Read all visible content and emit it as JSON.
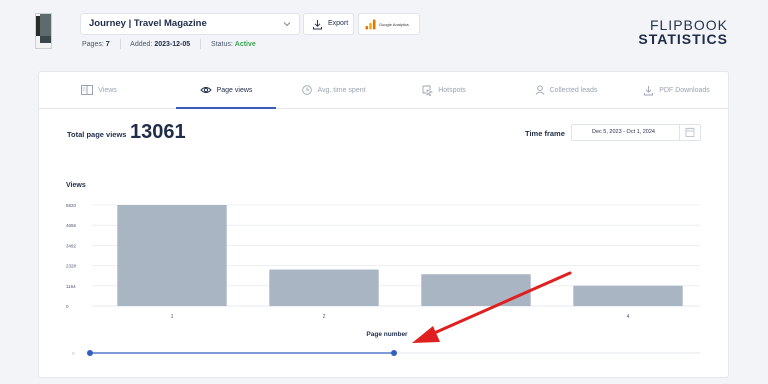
{
  "header": {
    "magazine_title": "Journey | Travel Magazine",
    "pages_label": "Pages:",
    "pages_value": "7",
    "added_label": "Added:",
    "added_value": "2023-12-05",
    "status_label": "Status:",
    "status_value": "Active",
    "export_label": "Export",
    "ga_label": "Google Analytics",
    "brand_line1": "FLIPBOOK",
    "brand_line2": "STATISTICS",
    "status_color": "#3aa655"
  },
  "tabs": [
    {
      "label": "Views",
      "icon": "views-icon",
      "active": false
    },
    {
      "label": "Page views",
      "icon": "eye-icon",
      "active": true
    },
    {
      "label": "Avg. time spent",
      "icon": "clock-icon",
      "active": false
    },
    {
      "label": "Hotspots",
      "icon": "hotspot-icon",
      "active": false
    },
    {
      "label": "Collected leads",
      "icon": "user-icon",
      "active": false
    },
    {
      "label": "PDF Downloads",
      "icon": "download-icon",
      "active": false
    }
  ],
  "summary": {
    "total_label": "Total page views",
    "total_value": "13061",
    "timeframe_label": "Time frame",
    "timeframe_value": "Dec 5, 2023 - Oct 1, 2024"
  },
  "chart_data": {
    "type": "bar",
    "ylabel": "Views",
    "xlabel": "Page number",
    "categories": [
      "1",
      "2",
      "",
      "4"
    ],
    "values": [
      5820,
      2100,
      1830,
      1170
    ],
    "yticks": [
      0,
      1164,
      2328,
      3492,
      4656,
      5820
    ],
    "ylim": [
      0,
      5820
    ],
    "bar_color": "#aab5c3",
    "grid": true
  },
  "slider": {
    "min_label": "0",
    "range_fraction": [
      0,
      0.5
    ],
    "accent": "#2f5fbf"
  },
  "annotation": {
    "type": "arrow",
    "color": "#e02020"
  }
}
